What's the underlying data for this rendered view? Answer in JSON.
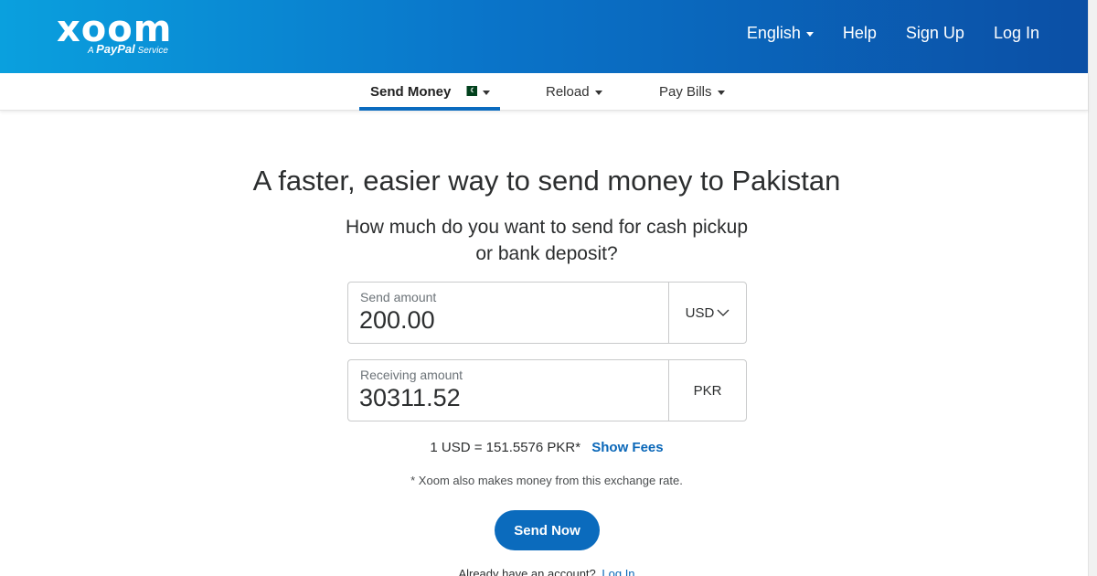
{
  "header": {
    "logo_text": "xoom",
    "logo_tag_prefix": "A",
    "logo_tag_brand": "PayPal",
    "logo_tag_suffix": "Service",
    "nav": {
      "language": "English",
      "help": "Help",
      "sign_up": "Sign Up",
      "log_in": "Log In"
    }
  },
  "subnav": {
    "tabs": [
      {
        "label": "Send Money",
        "active": true,
        "flag": "pakistan-flag-icon"
      },
      {
        "label": "Reload",
        "active": false
      },
      {
        "label": "Pay Bills",
        "active": false
      }
    ]
  },
  "main": {
    "headline": "A faster, easier way to send money to Pakistan",
    "question": "How much do you want to send for cash pickup or bank deposit?",
    "send": {
      "label": "Send amount",
      "value": "200.00",
      "currency": "USD"
    },
    "receive": {
      "label": "Receiving amount",
      "value": "30311.52",
      "currency": "PKR"
    },
    "rate_text": "1 USD = 151.5576 PKR*",
    "show_fees": "Show Fees",
    "note": "* Xoom also makes money from this exchange rate.",
    "send_button": "Send Now",
    "already_account": "Already have an account?",
    "login_link": "Log In"
  },
  "colors": {
    "header_gradient_start": "#0aa0de",
    "header_gradient_end": "#0b4fa5",
    "accent": "#0b6bbd",
    "link": "#0a67b8"
  }
}
